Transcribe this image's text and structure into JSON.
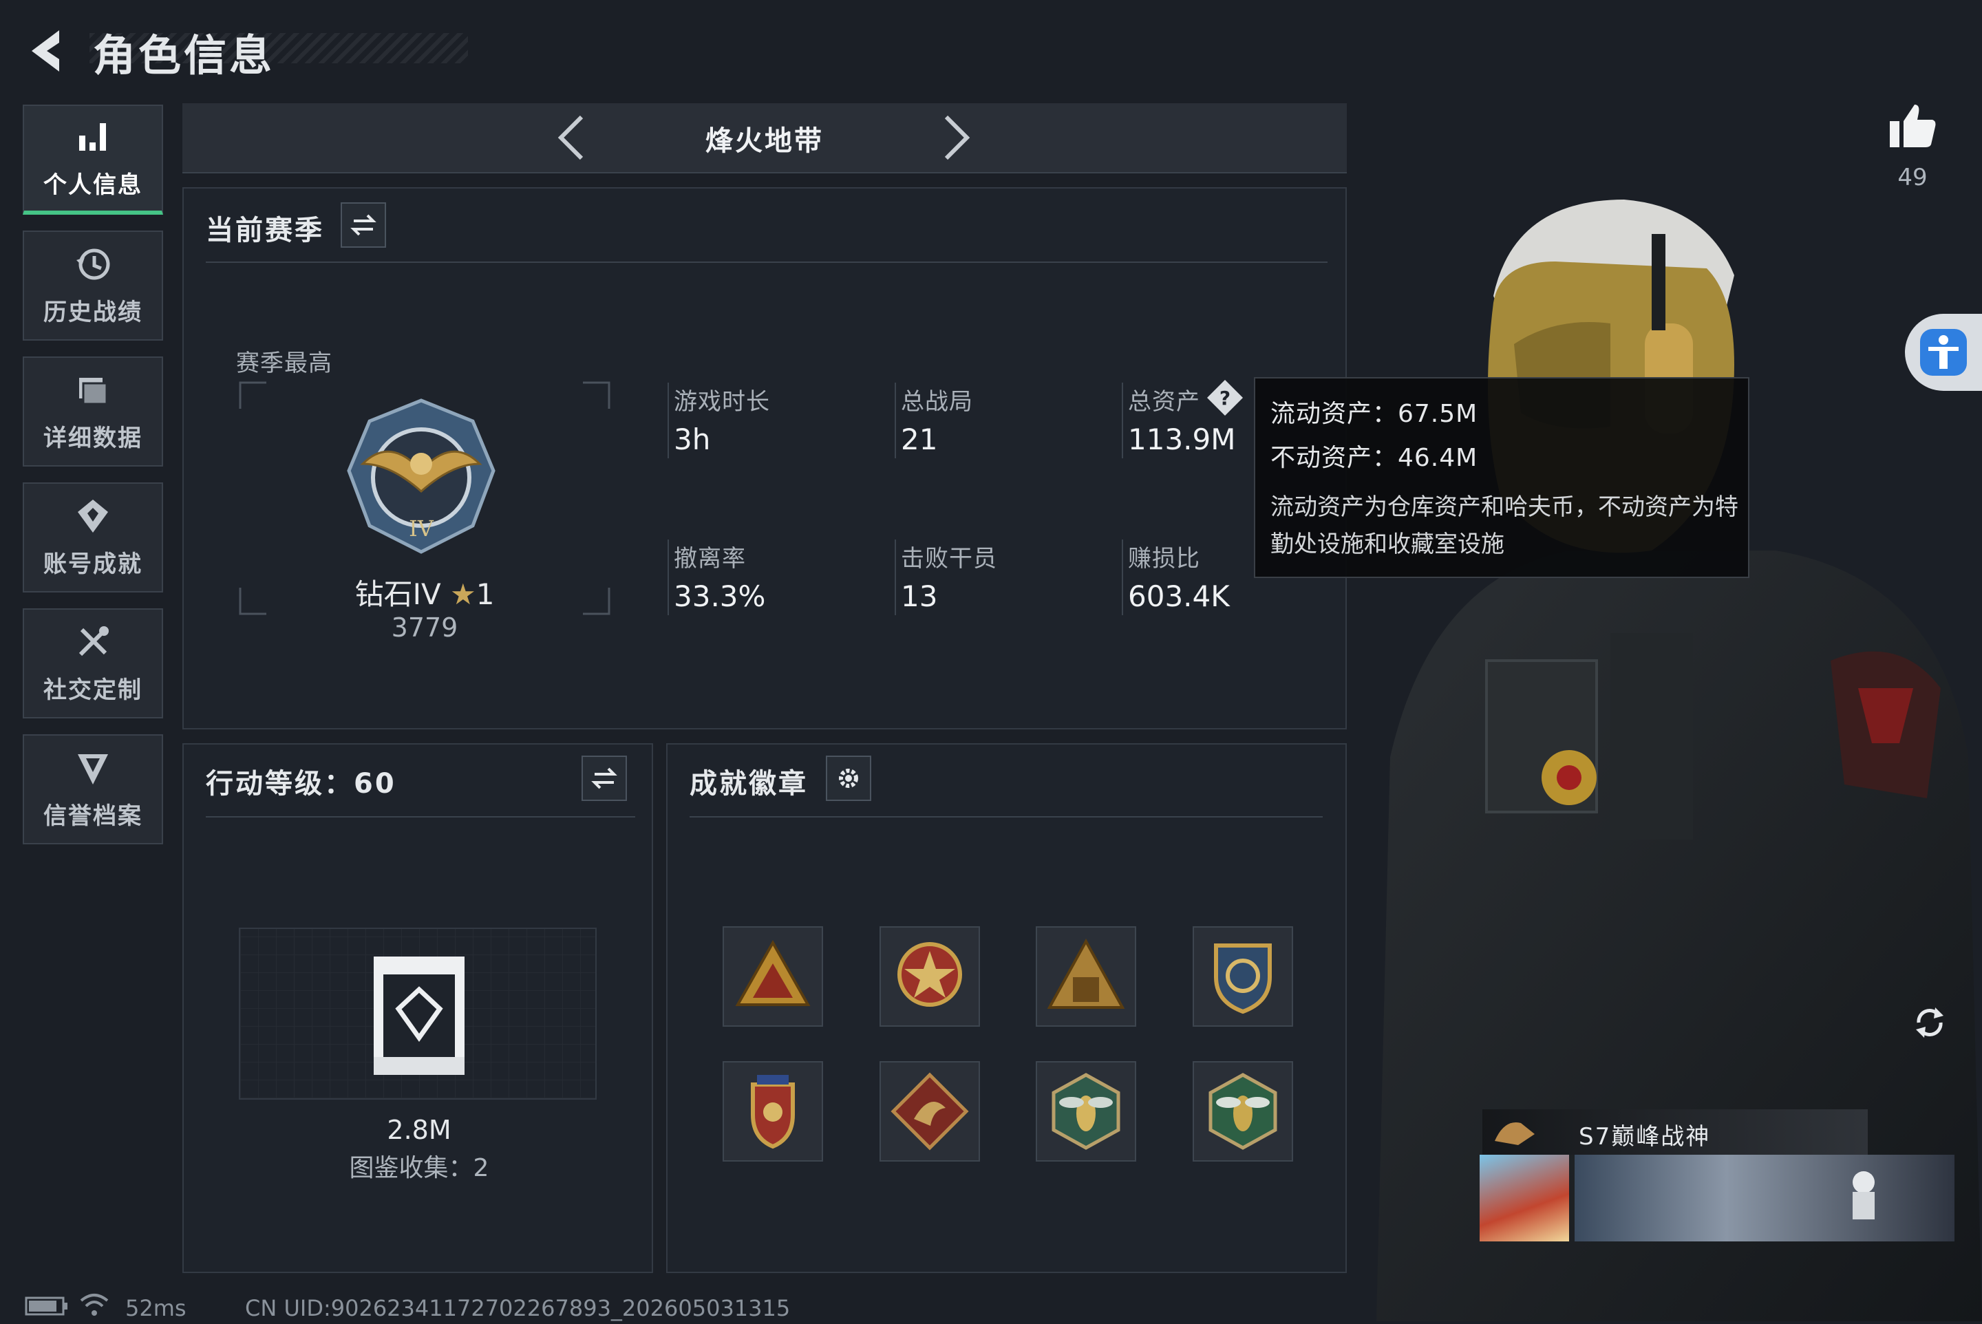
{
  "header": {
    "title": "角色信息"
  },
  "sidebar": {
    "items": [
      {
        "label": "个人信息",
        "icon": "bar-chart-icon",
        "active": true
      },
      {
        "label": "历史战绩",
        "icon": "history-clock-icon"
      },
      {
        "label": "详细数据",
        "icon": "folder-data-icon"
      },
      {
        "label": "账号成就",
        "icon": "achievement-icon"
      },
      {
        "label": "社交定制",
        "icon": "tools-icon"
      },
      {
        "label": "信誉档案",
        "icon": "reputation-icon"
      }
    ]
  },
  "mode": {
    "title": "烽火地带"
  },
  "season": {
    "section_title": "当前赛季",
    "best_label": "赛季最高",
    "rank_name": "钻石IV",
    "rank_stars": "1",
    "rank_points": "3779",
    "stats": [
      {
        "label": "游戏时长",
        "value": "3h"
      },
      {
        "label": "总战局",
        "value": "21"
      },
      {
        "label": "总资产",
        "value": "113.9M"
      },
      {
        "label": "撤离率",
        "value": "33.3%"
      },
      {
        "label": "击败干员",
        "value": "13"
      },
      {
        "label": "赚损比",
        "value": "603.4K"
      }
    ]
  },
  "tooltip": {
    "liquid": "流动资产：67.5M",
    "fixed": "不动资产：46.4M",
    "description": "流动资产为仓库资产和哈夫币，不动资产为特勤处设施和收藏室设施"
  },
  "action_level": {
    "section_title": "行动等级：60",
    "value": "2.8M",
    "collection": "图鉴收集：2"
  },
  "badges": {
    "section_title": "成就徽章",
    "items": [
      "triangle-badge-icon",
      "star-medal-icon",
      "triangle-figure-badge-icon",
      "shield-crest-icon",
      "winged-shield-icon",
      "dragon-badge-icon",
      "wasp-hex-badge-icon",
      "wasp-hex-badge-green-icon"
    ]
  },
  "right": {
    "like_count": "49",
    "season_title": "S7巅峰战神"
  },
  "status": {
    "ping": "52ms",
    "uid": "CN UID:902623411727022678​93_202605031315"
  },
  "colors": {
    "accent": "#45c486",
    "panel": "#1e232b",
    "blue_btn": "#2f7fe0"
  }
}
